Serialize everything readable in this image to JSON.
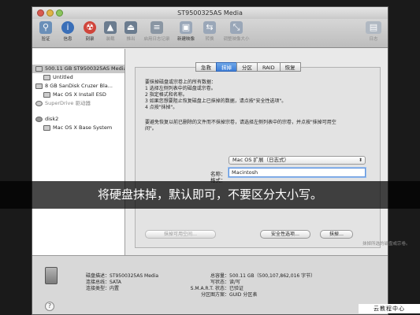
{
  "window": {
    "title": "ST9500325AS Media"
  },
  "toolbar": {
    "buttons": [
      {
        "label": "验证",
        "icon": "microscope-icon",
        "color": "#6a8fb8",
        "glyph": "⚲"
      },
      {
        "label": "信息",
        "icon": "info-icon",
        "color": "#3a6fb8",
        "glyph": "i"
      },
      {
        "label": "刻录",
        "icon": "burn-icon",
        "color": "#d0453b",
        "glyph": "☢"
      },
      {
        "label": "装载",
        "icon": "mount-icon",
        "color": "#6b7c8f",
        "glyph": "▲"
      },
      {
        "label": "推出",
        "icon": "eject-icon",
        "color": "#6b7c8f",
        "glyph": "⏏"
      },
      {
        "label": "启用日志记录",
        "icon": "journal-icon",
        "color": "#8a96a3",
        "glyph": "≡"
      },
      {
        "label": "新建映像",
        "icon": "new-image-icon",
        "color": "#9aa7b8",
        "glyph": "▣"
      },
      {
        "label": "转换",
        "icon": "convert-icon",
        "color": "#9aa7b8",
        "glyph": "⇆"
      },
      {
        "label": "调整映像大小",
        "icon": "resize-image-icon",
        "color": "#9aa7b8",
        "glyph": "⤡"
      }
    ],
    "log_label": "日志"
  },
  "sidebar": {
    "items": [
      {
        "label": "500.11 GB ST9500325AS Media",
        "selected": true
      },
      {
        "label": "Untitled",
        "selected": false
      },
      {
        "label": "8 GB SanDisk Cruzer Bla...",
        "selected": false
      },
      {
        "label": "Mac OS X Install ESD",
        "selected": false
      },
      {
        "label": "SuperDrive 驱动器",
        "selected": false
      },
      {
        "label": "disk2",
        "selected": false
      },
      {
        "label": "Mac OS X Base System",
        "selected": false
      }
    ]
  },
  "tabs": [
    {
      "label": "急救",
      "active": false
    },
    {
      "label": "抹掉",
      "active": true
    },
    {
      "label": "分区",
      "active": false
    },
    {
      "label": "RAID",
      "active": false
    },
    {
      "label": "恢复",
      "active": false
    }
  ],
  "erase": {
    "intro": "要抹掉磁盘或宗卷上的所有数据：",
    "steps": [
      "1 选择左侧列表中的磁盘或宗卷。",
      "2 指定格式和名称。",
      "3 如果您想要阻止恢复磁盘上已抹掉的数据，请点按\"安全性选项\"。",
      "4 点按\"抹掉\"。"
    ],
    "note1": "要避免恢复以前已删除的文件而不抹掉宗卷，请选择左侧列表中的宗卷，并点按\"抹掉可用空",
    "note2": "间\"。",
    "format_label": "格式：",
    "format_value": "Mac OS 扩展（日志式）",
    "name_label": "名称：",
    "name_value": "Macintosh",
    "erase_free_space_button": "抹掉可用空间…",
    "security_options_button": "安全性选项…",
    "erase_button": "抹掉…"
  },
  "info": {
    "disk_desc_label": "磁盘描述：",
    "disk_desc": "ST9500325AS Media",
    "connection_bus_label": "连接总线：",
    "connection_bus": "SATA",
    "connection_type_label": "连接类型：",
    "connection_type": "内置",
    "total_capacity_label": "总容量：",
    "total_capacity": "500.11 GB（500,107,862,016 字节）",
    "write_status_label": "写状态：",
    "write_status": "读/写",
    "smart_label": "S.M.A.R.T. 状态：",
    "smart": "已验证",
    "partition_map_label": "分区图方案：",
    "partition_map": "GUID 分区表"
  },
  "overlay": {
    "subtitle": "将硬盘抹掉，默认即可，不要区分大小写。",
    "tooltip": "抹掉所选的磁盘或宗卷。",
    "watermark": "云教程中心"
  }
}
